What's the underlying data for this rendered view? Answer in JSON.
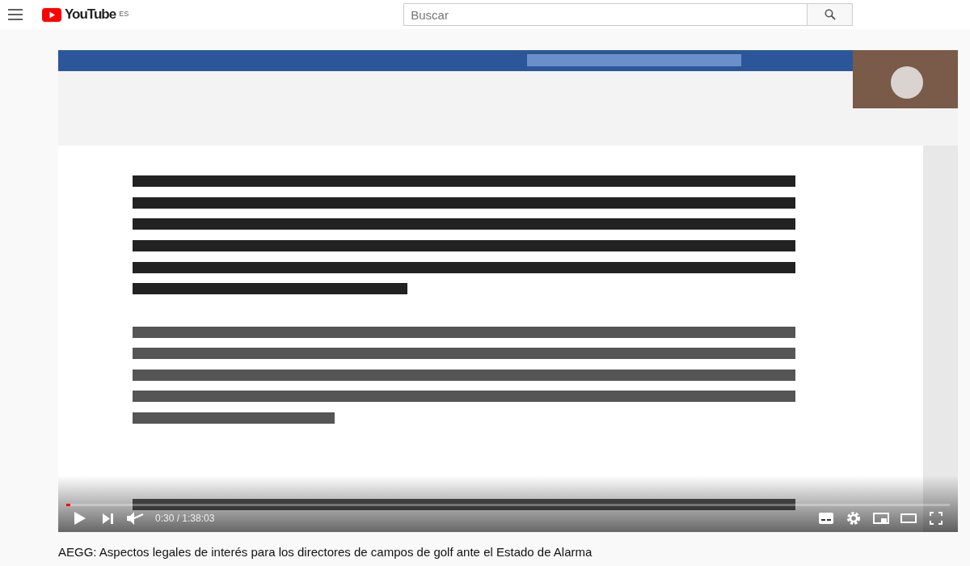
{
  "header": {
    "logo_text": "YouTube",
    "region": "ES",
    "search": {
      "placeholder": "Buscar"
    }
  },
  "player": {
    "kind": "picture",
    "progress": {
      "level": 0.005
    },
    "muted": true,
    "time": "0:30 / 1:38:03"
  },
  "video_title": "AEGG: Aspectos legales de interés para los directores de campos de golf ante el Estado de Alarma"
}
